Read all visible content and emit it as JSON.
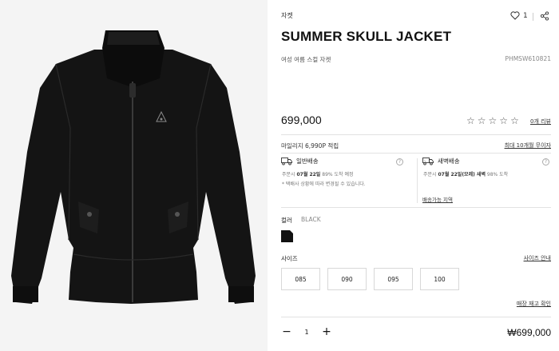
{
  "product": {
    "category": "자켓",
    "title": "SUMMER SKULL JACKET",
    "subtitle": "여성 여름 스컬 자켓",
    "code": "PHMSW610821",
    "like_count": "1",
    "price": "699,000",
    "review_link": "0개 리뷰",
    "mileage": "마일리지 6,990P 적립",
    "installment_link": "최대 10개월 무이자"
  },
  "shipping": {
    "normal": {
      "title": "일반배송",
      "line1_prefix": "주문시",
      "line1_date": "07월 22일",
      "line1_suffix": "89% 도착 예정",
      "line2": "* 택배사 상황에 따라 변경될 수 있습니다."
    },
    "dawn": {
      "title": "새벽배송",
      "line1_prefix": "주문시",
      "line1_date": "07월 22일(모레) 새벽",
      "line1_suffix": "98% 도착",
      "region_link": "배송가능 지역"
    },
    "help_glyph": "?"
  },
  "options": {
    "color_label": "컬러",
    "color_value": "BLACK",
    "swatch_color": "#111111",
    "size_label": "사이즈",
    "size_guide": "사이즈 안내",
    "sizes": [
      "085",
      "090",
      "095",
      "100"
    ],
    "stock_link": "매장 재고 확인"
  },
  "purchase": {
    "qty_minus": "−",
    "qty_value": "1",
    "qty_plus": "+",
    "total": "₩699,000"
  },
  "icons": {
    "heart": "heart-icon",
    "share": "share-icon",
    "star_glyph": "☆",
    "truck": "truck-icon",
    "dawn_truck": "dawn-truck-icon"
  },
  "colors": {
    "jacket": "#141414",
    "background": "#f4f4f4",
    "divider": "#e2e2e2"
  }
}
